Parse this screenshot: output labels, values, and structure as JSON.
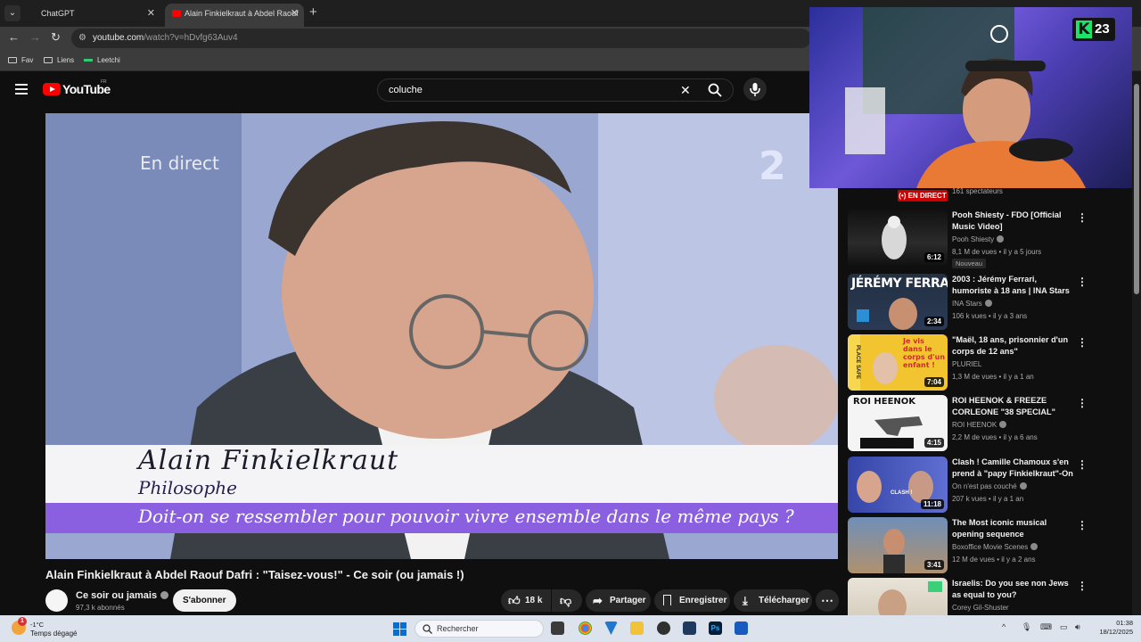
{
  "browser": {
    "tabs": [
      {
        "label": "ChatGPT",
        "active": false
      },
      {
        "label": "Alain Finkielkraut à Abdel Raouf",
        "active": true
      }
    ],
    "url_host": "youtube.com",
    "url_path": "/watch?v=hDvfg63Auv4",
    "bookmarks": [
      "Fav",
      "Liens",
      "Leetchi"
    ]
  },
  "youtube": {
    "logo_text": "YouTube",
    "country_code": "FR",
    "search_value": "coluche"
  },
  "video": {
    "overlay_top_left": "En direct",
    "channel_logo_overlay": "2",
    "lower_third_name": "Alain Finkielkraut",
    "lower_third_role": "Philosophe",
    "lower_third_question": "Doit-on se ressembler pour pouvoir vivre ensemble dans le même pays ?",
    "title": "Alain Finkielkraut à Abdel Raouf Dafri : \"Taisez-vous!\" - Ce soir (ou jamais !)",
    "channel_name": "Ce soir ou jamais",
    "subscribers": "97,3 k abonnés",
    "subscribe_label": "S'abonner",
    "likes": "18 k",
    "share_label": "Partager",
    "save_label": "Enregistrer",
    "download_label": "Télécharger"
  },
  "stream_overlay": {
    "badge_number": "23",
    "badge_letter": "K"
  },
  "sidebar": {
    "live_badge": "EN DIRECT",
    "live_viewers": "161 spectateurs",
    "items": [
      {
        "title": "Pooh Shiesty - FDO [Official Music Video]",
        "channel": "Pooh Shiesty",
        "meta": "8,1 M de vues • il y a 5 jours",
        "duration": "6:12",
        "badge": "Nouveau",
        "verified": true
      },
      {
        "title": "2003 : Jérémy Ferrari, humoriste à 18 ans | INA Stars",
        "channel": "INA Stars",
        "meta": "106 k vues • il y a 3 ans",
        "duration": "2:34",
        "thumb_text": "JÉRÉMY FERRARI",
        "verified": true
      },
      {
        "title": "\"Maël, 18 ans, prisonnier d'un corps de 12 ans\"",
        "channel": "PLURIEL",
        "meta": "1,3 M de vues • il y a 1 an",
        "duration": "7:04",
        "thumb_text": "Je vis dans le corps d'un enfant !",
        "verified": false
      },
      {
        "title": "ROI HEENOK & FREEZE CORLEONE \"38 SPECIAL\"",
        "channel": "ROI HEENOK",
        "meta": "2,2 M de vues • il y a 6 ans",
        "duration": "4:15",
        "thumb_text": "ROI HEENOK",
        "verified": true
      },
      {
        "title": "Clash ! Camille Chamoux s'en prend à \"papy Finkielkraut\"-On ...",
        "channel": "On n'est pas couché",
        "meta": "207 k vues • il y a 1 an",
        "duration": "11:18",
        "thumb_text": "CLASH !",
        "verified": true
      },
      {
        "title": "The Most iconic musical opening sequence",
        "channel": "Boxoffice Movie Scenes",
        "meta": "12 M de vues • il y a 2 ans",
        "duration": "3:41",
        "verified": true
      },
      {
        "title": "Israelis: Do you see non Jews as equal to you?",
        "channel": "Corey Gil-Shuster",
        "meta": "",
        "duration": "",
        "verified": false
      }
    ]
  },
  "taskbar": {
    "temperature": "-1°C",
    "weather": "Temps dégagé",
    "weather_alert_count": "1",
    "search_placeholder": "Rechercher",
    "time": "01:38",
    "date": "18/12/2025"
  },
  "colors": {
    "yt_red": "#ff0000",
    "live_red": "#cc0000",
    "purple_band": "#8a5fe0",
    "badge_green": "#1ee26a"
  }
}
